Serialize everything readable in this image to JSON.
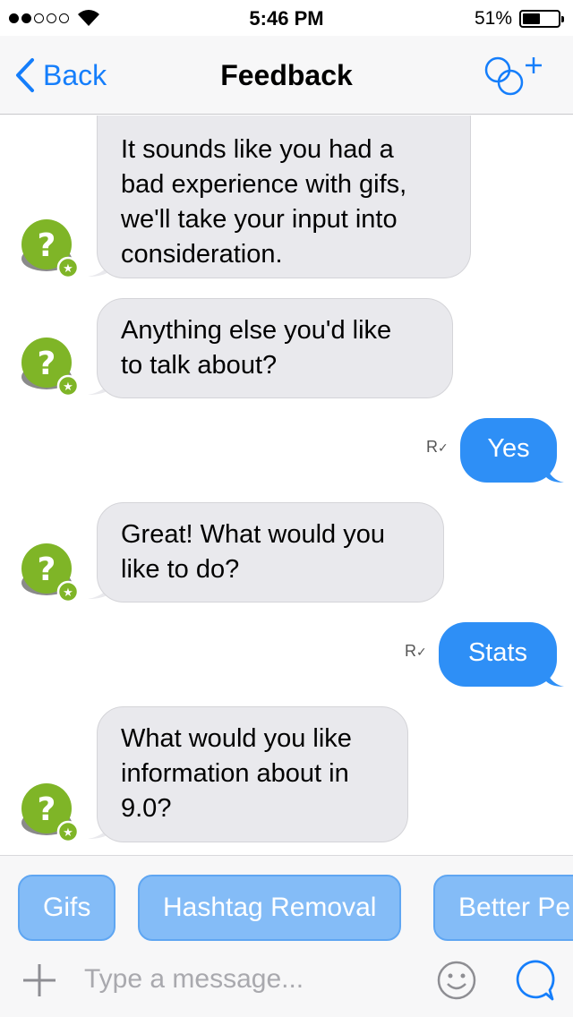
{
  "status_bar": {
    "time": "5:46 PM",
    "battery_percent": "51%",
    "battery_level": 0.51,
    "signal_filled": 2,
    "signal_total": 5
  },
  "nav": {
    "back_label": "Back",
    "title": "Feedback",
    "right_icon": "new-group-icon"
  },
  "messages": [
    {
      "from": "bot",
      "text_lines": [
        "It sounds like you had a",
        "bad experience with gifs,",
        "we'll take your input into",
        "consideration."
      ]
    },
    {
      "from": "bot",
      "text_lines": [
        "Anything else you'd like",
        "to talk about?"
      ]
    },
    {
      "from": "user",
      "text": "Yes",
      "receipt": "R"
    },
    {
      "from": "bot",
      "text_lines": [
        "Great! What would you",
        "like to do?"
      ]
    },
    {
      "from": "user",
      "text": "Stats",
      "receipt": "R"
    },
    {
      "from": "bot",
      "text_lines": [
        "What would you like",
        "information about in",
        "9.0?"
      ]
    }
  ],
  "quick_replies": [
    "Gifs",
    "Hashtag Removal",
    "Better Pe"
  ],
  "composer": {
    "placeholder": "Type a message...",
    "icons": [
      "plus-icon",
      "emoji-icon",
      "send-icon"
    ]
  },
  "colors": {
    "accent": "#157efb",
    "outgoing_bubble": "#2e8ff6",
    "incoming_bubble": "#e9e9ed",
    "avatar_green": "#7fb527",
    "chip": "#84bcf7"
  }
}
